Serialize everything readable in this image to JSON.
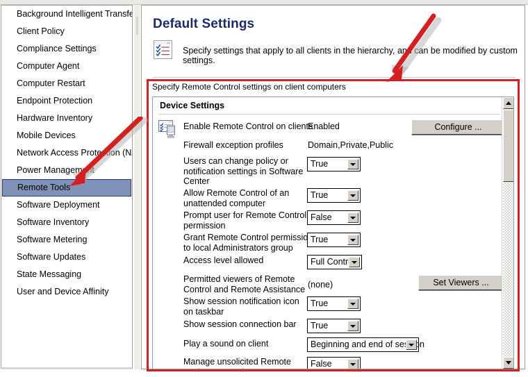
{
  "sidebar": {
    "items": [
      {
        "label": "Background Intelligent Transfer",
        "selected": false
      },
      {
        "label": "Client Policy",
        "selected": false
      },
      {
        "label": "Compliance Settings",
        "selected": false
      },
      {
        "label": "Computer Agent",
        "selected": false
      },
      {
        "label": "Computer Restart",
        "selected": false
      },
      {
        "label": "Endpoint Protection",
        "selected": false
      },
      {
        "label": "Hardware Inventory",
        "selected": false
      },
      {
        "label": "Mobile Devices",
        "selected": false
      },
      {
        "label": "Network Access Protection (NAP)",
        "selected": false
      },
      {
        "label": "Power Management",
        "selected": false
      },
      {
        "label": "Remote Tools",
        "selected": true
      },
      {
        "label": "Software Deployment",
        "selected": false
      },
      {
        "label": "Software Inventory",
        "selected": false
      },
      {
        "label": "Software Metering",
        "selected": false
      },
      {
        "label": "Software Updates",
        "selected": false
      },
      {
        "label": "State Messaging",
        "selected": false
      },
      {
        "label": "User and Device Affinity",
        "selected": false
      }
    ]
  },
  "header": {
    "title": "Default Settings",
    "description": "Specify settings that apply to all clients in the hierarchy, and can be modified by custom settings.",
    "icon": "settings-list-icon"
  },
  "settings": {
    "caption": "Specify Remote Control settings on client computers",
    "group_title": "Device Settings",
    "group_icon": "device-settings-icon",
    "rows": [
      {
        "label": "Enable Remote Control on clients",
        "value": "Enabled",
        "control": "text",
        "button": "Configure ..."
      },
      {
        "label": "Firewall exception profiles",
        "value": "Domain,Private,Public",
        "control": "text"
      },
      {
        "label": "Users can change policy or notification settings in Software Center",
        "value": "True",
        "control": "combo"
      },
      {
        "label": "Allow Remote Control of an unattended computer",
        "value": "True",
        "control": "combo"
      },
      {
        "label": "Prompt user for Remote Control permission",
        "value": "False",
        "control": "combo"
      },
      {
        "label": "Grant Remote Control permission to local Administrators group",
        "value": "True",
        "control": "combo"
      },
      {
        "label": "Access level allowed",
        "value": "Full Control",
        "control": "combo"
      },
      {
        "label": "Permitted viewers of Remote Control and Remote Assistance",
        "value": "(none)",
        "control": "text",
        "button": "Set Viewers ..."
      },
      {
        "label": "Show session notification icon on taskbar",
        "value": "True",
        "control": "combo"
      },
      {
        "label": "Show session connection bar",
        "value": "True",
        "control": "combo"
      },
      {
        "label": "Play a sound on client",
        "value": "Beginning and end of session",
        "control": "combo"
      },
      {
        "label": "Manage unsolicited Remote Assistance settings",
        "value": "False",
        "control": "combo"
      }
    ]
  },
  "colors": {
    "title": "#1a2a6c",
    "selection_fill": "#8092b8",
    "selection_border": "#27348b",
    "annotation_red": "#d42020",
    "button_face": "#d4d0c8"
  },
  "annotations": {
    "arrow_left": "red-arrow-pointing-to-remote-tools",
    "arrow_right": "red-arrow-pointing-to-settings-panel"
  }
}
